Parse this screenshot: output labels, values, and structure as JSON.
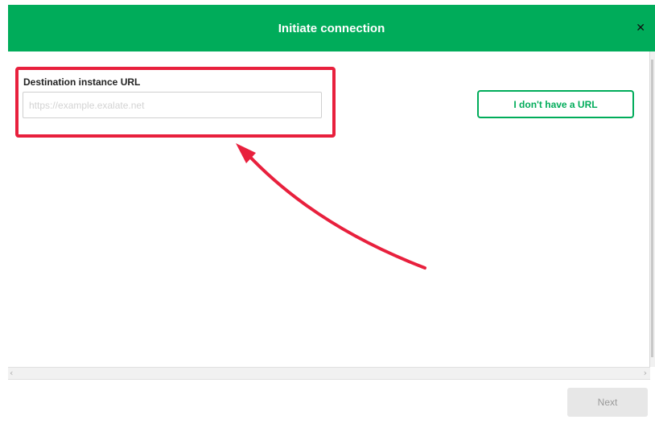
{
  "dialog": {
    "title": "Initiate connection",
    "close_icon": "close-icon"
  },
  "form": {
    "field_label": "Destination instance URL",
    "url_input": {
      "value": "",
      "placeholder": "https://example.exalate.net"
    },
    "no_url_button_label": "I don't have a URL"
  },
  "footer": {
    "next_label": "Next",
    "next_enabled": false
  },
  "annotation": {
    "highlight_color": "#e8203d",
    "arrow_color": "#e8203d"
  },
  "colors": {
    "brand_green": "#00ac5a",
    "header_text": "#ffffff"
  }
}
